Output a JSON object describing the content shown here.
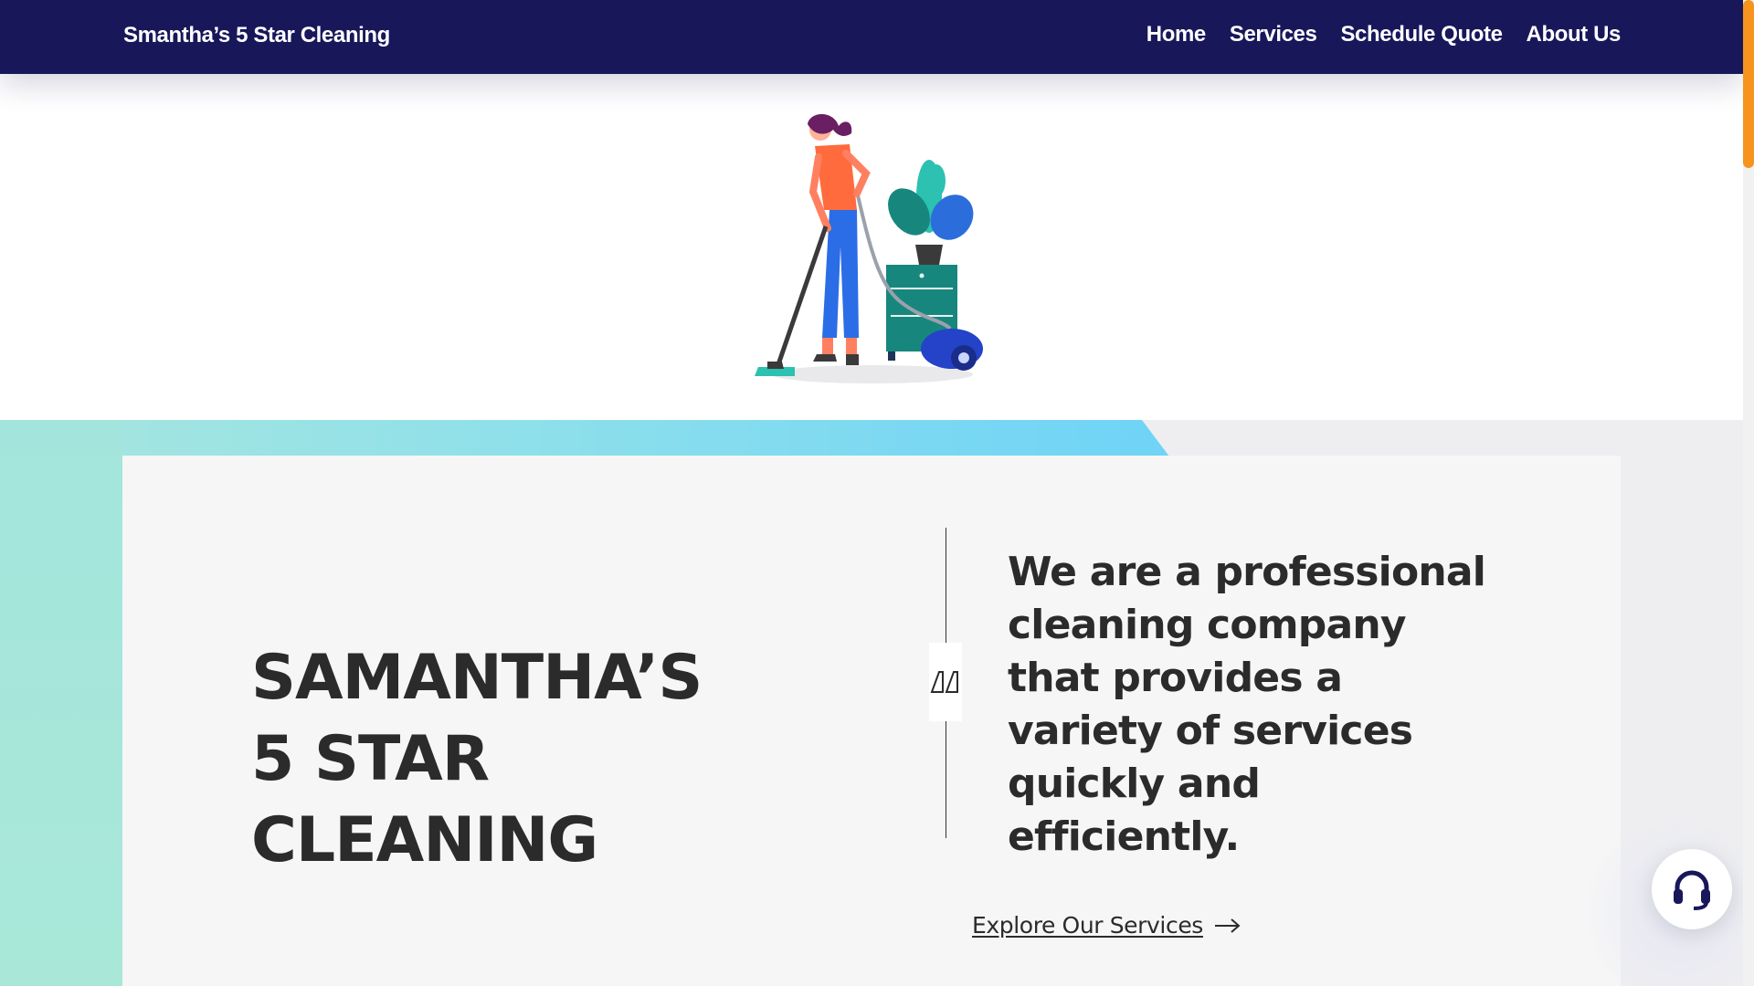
{
  "header": {
    "brand": "Smantha’s 5 Star Cleaning",
    "nav": [
      "Home",
      "Services",
      "Schedule Quote",
      "About Us"
    ]
  },
  "hero": {
    "illustration": "woman-vacuuming-illustration"
  },
  "intro": {
    "title_lines": [
      "SAMANTHA’S",
      "5 STAR",
      "CLEANING"
    ],
    "quote": "We are a professional cleaning company that provides a variety of services quickly and efficiently.",
    "quote_icon": "quote-mark-icon",
    "cta": "Explore Our Services",
    "cta_icon": "arrow-right-icon"
  },
  "support": {
    "icon": "headset-icon"
  },
  "colors": {
    "header_bg": "#18175a",
    "accent_scroll": "#f7941d",
    "text_dark": "#2b2b2b",
    "band_gradient_start": "#a8e6dd",
    "band_gradient_end": "#6fd3f7"
  }
}
